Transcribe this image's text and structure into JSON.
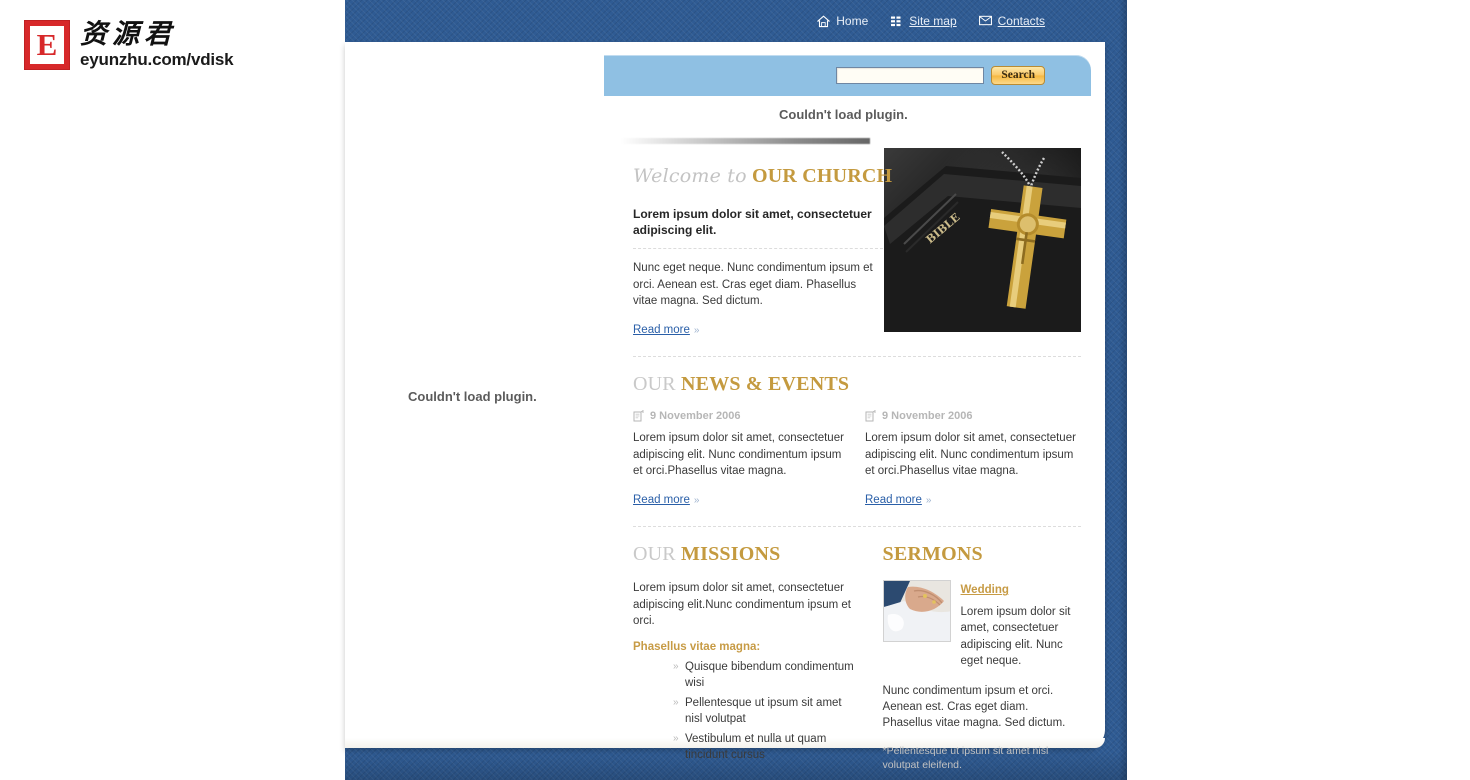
{
  "brand": {
    "mark_letter": "E",
    "name_cn": "资源君",
    "url": "eyunzhu.com/vdisk"
  },
  "topnav": {
    "items": [
      {
        "label": "Home",
        "icon": "home-icon"
      },
      {
        "label": "Site map",
        "icon": "sitemap-icon"
      },
      {
        "label": "Contacts",
        "icon": "envelope-icon"
      }
    ]
  },
  "search": {
    "value": "",
    "placeholder": "",
    "button_label": "Search"
  },
  "notices": {
    "banner": "Couldn't load plugin.",
    "left": "Couldn't load plugin."
  },
  "welcome": {
    "head_grey": "Welcome to",
    "head_gold": "OUR CHURCH",
    "lead": "Lorem ipsum dolor sit amet, consectetuer adipiscing elit.",
    "body": "Nunc eget neque. Nunc condimentum ipsum et orci. Aenean est. Cras eget diam. Phasellus vitae magna. Sed dictum.",
    "read_more": "Read more",
    "read_more_arrow": "»",
    "photo_alt": "gold-crucifix-on-bible-photo"
  },
  "news": {
    "head_grey": "OUR",
    "head_gold": "NEWS & EVENTS",
    "items": [
      {
        "date": "9 November 2006",
        "body": "Lorem ipsum dolor sit amet, consectetuer adipiscing elit. Nunc condimentum ipsum et orci.Phasellus vitae magna.",
        "read_more": "Read more",
        "read_more_arrow": "»"
      },
      {
        "date": "9 November 2006",
        "body": "Lorem ipsum dolor sit amet, consectetuer adipiscing elit. Nunc condimentum ipsum et orci.Phasellus vitae magna.",
        "read_more": "Read more",
        "read_more_arrow": "»"
      }
    ]
  },
  "missions": {
    "head_grey": "OUR",
    "head_gold": "MISSIONS",
    "body": "Lorem ipsum dolor sit amet, consectetuer adipiscing elit.Nunc condimentum ipsum et orci.",
    "subhead": "Phasellus vitae magna:",
    "bullets": [
      "Quisque bibendum condimentum wisi",
      "Pellentesque ut ipsum sit amet nisl volutpat",
      "Vestibulum et nulla ut quam tincidunt cursus"
    ]
  },
  "sermons": {
    "head_gold": "SERMONS",
    "thumb_alt": "wedding-hands-rings-photo",
    "title": "Wedding",
    "excerpt": "Lorem ipsum dolor sit amet, consectetuer adipiscing elit. Nunc eget neque.",
    "body": "Nunc condimentum ipsum et orci. Aenean est. Cras eget diam. Phasellus vitae magna. Sed dictum.",
    "footnote": "*Pellentesque ut ipsum sit amet nisl volutpat eleifend."
  },
  "colors": {
    "frame_blue": "#2f5b93",
    "search_band": "#8fc0e3",
    "gold": "#c49a3f",
    "link_blue": "#2a5fa8",
    "head_grey": "#c9c9c9",
    "brand_red": "#d7282a"
  }
}
